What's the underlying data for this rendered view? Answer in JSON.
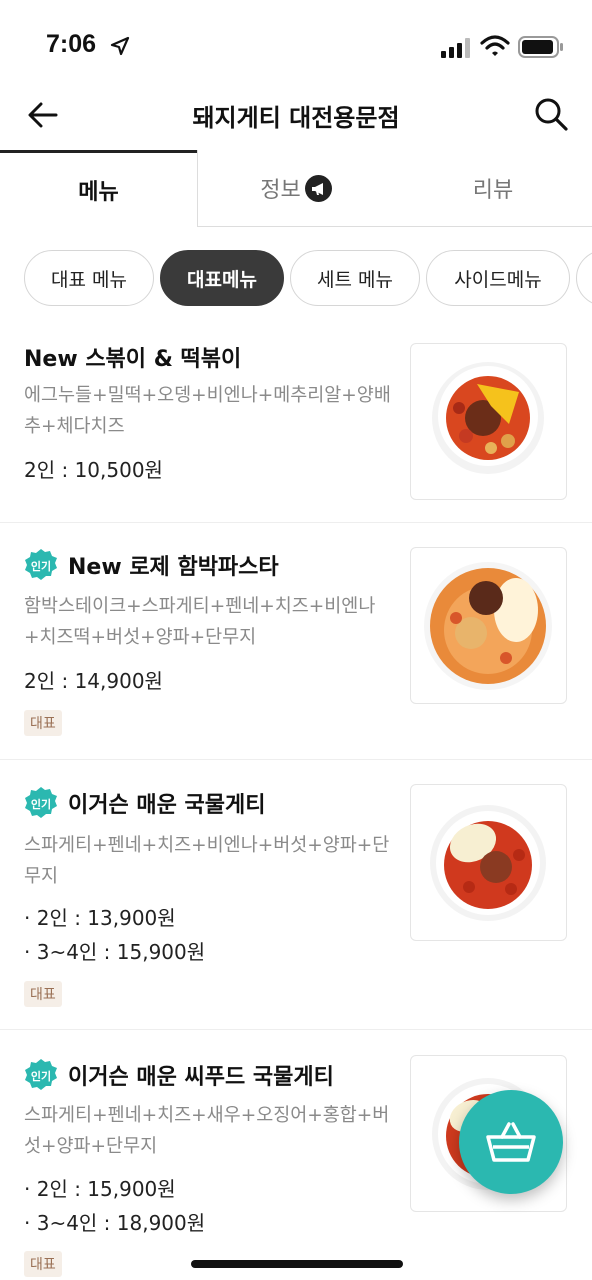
{
  "status_bar": {
    "time": "7:06"
  },
  "header": {
    "title": "돼지게티 대전용문점"
  },
  "tabs": [
    {
      "label": "메뉴"
    },
    {
      "label": "정보"
    },
    {
      "label": "리뷰"
    }
  ],
  "chips": [
    {
      "label": "대표 메뉴"
    },
    {
      "label": "대표메뉴"
    },
    {
      "label": "세트 메뉴"
    },
    {
      "label": "사이드메뉴"
    }
  ],
  "menu_items": [
    {
      "name": "New 스볶이 & 떡볶이",
      "popular": false,
      "description": "에그누들+밀떡+오뎅+비엔나+메추리알+양배추+체다치즈",
      "prices": [
        "2인 : 10,500원"
      ],
      "tag": ""
    },
    {
      "name": "New 로제 함박파스타",
      "popular": true,
      "popular_label": "인기",
      "description": "함박스테이크+스파게티+펜네+치즈+비엔나+치즈떡+버섯+양파+단무지",
      "prices": [
        "2인 : 14,900원"
      ],
      "tag": "대표"
    },
    {
      "name": "이거슨 매운 국물게티",
      "popular": true,
      "popular_label": "인기",
      "description": "스파게티+펜네+치즈+비엔나+버섯+양파+단무지",
      "prices": [
        "· 2인 : 13,900원",
        "· 3~4인 : 15,900원"
      ],
      "tag": "대표"
    },
    {
      "name": "이거슨 매운 씨푸드 국물게티",
      "popular": true,
      "popular_label": "인기",
      "description": "스파게티+펜네+치즈+새우+오징어+홍합+버섯+양파+단무지",
      "prices": [
        "· 2인 : 15,900원",
        "· 3~4인 : 18,900원"
      ],
      "tag": "대표"
    }
  ],
  "colors": {
    "accent_teal": "#2bb8b0",
    "chip_active": "#3a3a3a",
    "tag_bg": "#f5eee7",
    "tag_text": "#9a7055"
  },
  "icons": [
    "location-arrow-icon",
    "signal-icon",
    "wifi-icon",
    "battery-icon",
    "back-arrow-icon",
    "search-icon",
    "megaphone-icon",
    "popular-badge-icon",
    "basket-icon"
  ]
}
